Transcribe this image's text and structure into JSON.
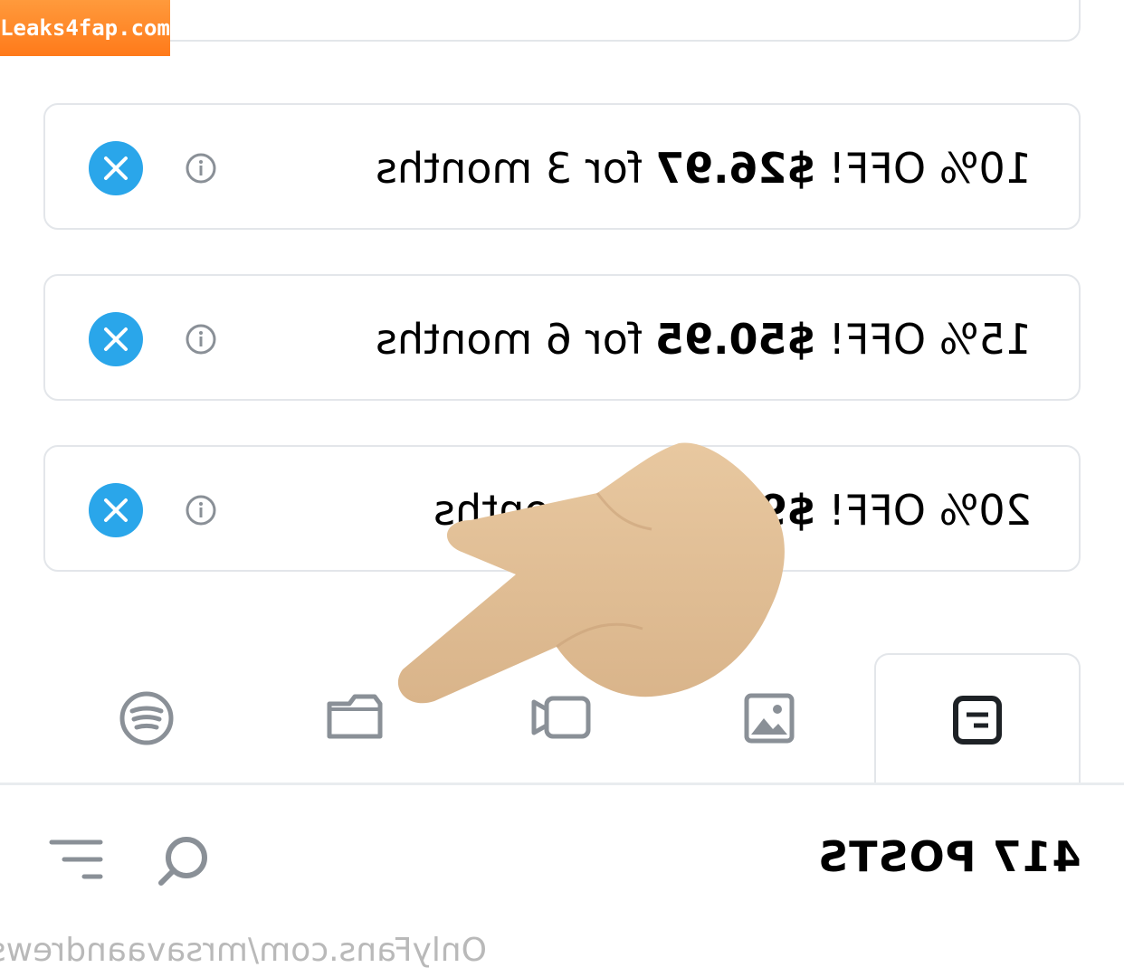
{
  "watermark": {
    "label": "Leaks4fap.com"
  },
  "offers": [
    {
      "discount": "10% OFF!",
      "price": "$26.97",
      "term": "for 3 months"
    },
    {
      "discount": "15% OFF!",
      "price": "$50.95",
      "term": "for 6 months"
    },
    {
      "discount": "20% OFF!",
      "price": "$9",
      "term": "onths"
    }
  ],
  "tabs": [
    {
      "icon": "posts-icon",
      "active": true
    },
    {
      "icon": "photo-icon",
      "active": false
    },
    {
      "icon": "video-icon",
      "active": false
    },
    {
      "icon": "folder-icon",
      "active": false
    },
    {
      "icon": "audio-icon",
      "active": false
    }
  ],
  "posts": {
    "count_label": "417 POSTS"
  },
  "footer": {
    "source": "OnlyFans.com/mrsavaandrews"
  },
  "colors": {
    "accent": "#2aa6ea",
    "icon": "#8a9097"
  }
}
